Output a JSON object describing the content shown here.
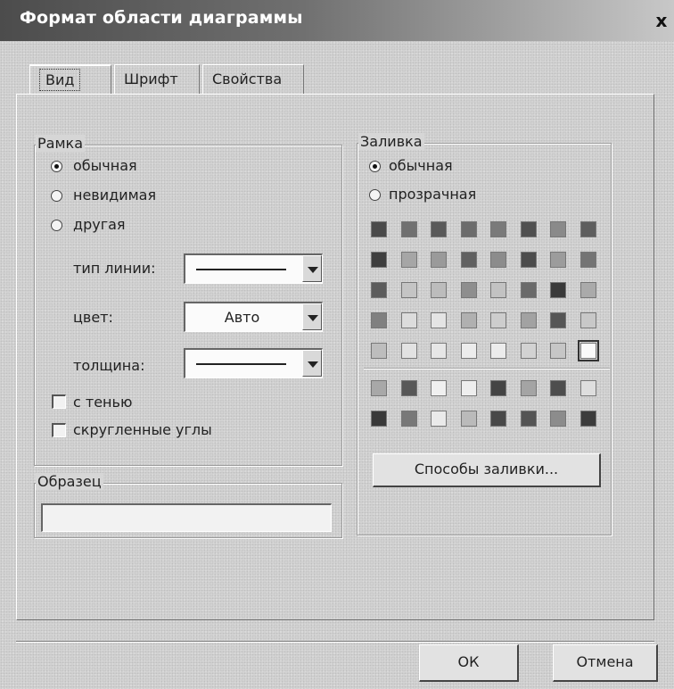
{
  "window": {
    "title": "Формат области диаграммы",
    "close_glyph": "x"
  },
  "tabs": [
    {
      "label": "Вид",
      "active": true
    },
    {
      "label": "Шрифт",
      "active": false
    },
    {
      "label": "Свойства",
      "active": false
    }
  ],
  "frame": {
    "legend": "Рамка",
    "options": [
      {
        "label": "обычная",
        "checked": true
      },
      {
        "label": "невидимая",
        "checked": false
      },
      {
        "label": "другая",
        "checked": false
      }
    ],
    "line_type_label": "тип линии:",
    "color_label": "цвет:",
    "color_value": "Авто",
    "thickness_label": "толщина:",
    "shadow_label": "с тенью",
    "shadow_checked": false,
    "rounded_label": "скругленные углы",
    "rounded_checked": false
  },
  "sample": {
    "legend": "Образец"
  },
  "fill": {
    "legend": "Заливка",
    "options": [
      {
        "label": "обычная",
        "checked": true
      },
      {
        "label": "прозрачная",
        "checked": false
      }
    ],
    "palette_main": [
      [
        "#4a4a4a",
        "#707070",
        "#5a5a5a",
        "#6c6c6c",
        "#7a7a7a",
        "#505050",
        "#8a8a8a",
        "#5e5e5e"
      ],
      [
        "#3e3e3e",
        "#a6a6a6",
        "#9a9a9a",
        "#606060",
        "#8c8c8c",
        "#4c4c4c",
        "#9c9c9c",
        "#747474"
      ],
      [
        "#5c5c5c",
        "#c4c4c4",
        "#bcbcbc",
        "#8e8e8e",
        "#c2c2c2",
        "#6a6a6a",
        "#3a3a3a",
        "#aaaaaa"
      ],
      [
        "#808080",
        "#dcdcdc",
        "#e4e4e4",
        "#b0b0b0",
        "#cdcdcd",
        "#a2a2a2",
        "#565656",
        "#c8c8c8"
      ],
      [
        "#bdbdbd",
        "#e2e2e2",
        "#e6e6e6",
        "#ececec",
        "#ececec",
        "#d2d2d2",
        "#c6c6c6",
        "#fafafa"
      ]
    ],
    "palette_extra": [
      [
        "#a8a8a8",
        "#585858",
        "#f0f0f0",
        "#eeeeee",
        "#444444",
        "#a4a4a4",
        "#4e4e4e",
        "#dedede"
      ],
      [
        "#383838",
        "#787878",
        "#eaeaea",
        "#bababa",
        "#484848",
        "#545454",
        "#8c8c8c",
        "#3c3c3c"
      ]
    ],
    "fill_effects_button": "Способы заливки..."
  },
  "buttons": {
    "ok": "ОК",
    "cancel": "Отмена"
  }
}
